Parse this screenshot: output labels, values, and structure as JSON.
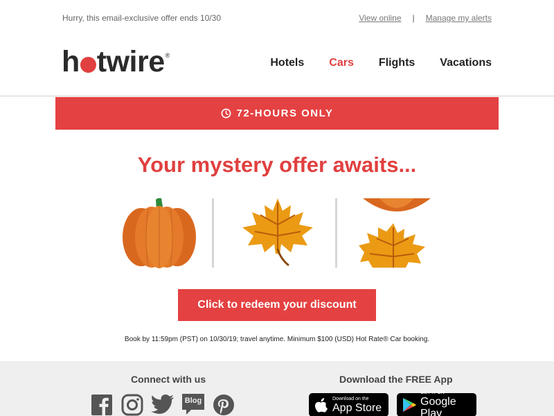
{
  "preheader": {
    "text": "Hurry, this email-exclusive offer ends 10/30",
    "view_online": "View online",
    "separator": "|",
    "manage_alerts": "Manage my alerts"
  },
  "brand": {
    "logo_left": "h",
    "logo_right": "twire",
    "registered": "®",
    "accent_color": "#e0403f"
  },
  "nav": {
    "items": [
      {
        "label": "Hotels"
      },
      {
        "label": "Cars"
      },
      {
        "label": "Flights"
      },
      {
        "label": "Vacations"
      }
    ]
  },
  "banner": {
    "text": "72-HOURS ONLY",
    "icon": "clock-icon"
  },
  "headline": "Your mystery offer awaits...",
  "images": {
    "icons": [
      "pumpkin-icon",
      "maple-leaf-icon",
      "partial-pumpkin-and-leaf-icon"
    ]
  },
  "cta": {
    "label": "Click to redeem your discount"
  },
  "fine_print": "Book by 11:59pm (PST) on 10/30/19; travel anytime. Minimum $100 (USD) Hot Rate® Car booking.",
  "footer": {
    "connect_title": "Connect with us",
    "app_title": "Download the FREE App",
    "social": [
      "facebook-icon",
      "instagram-icon",
      "twitter-icon",
      "blog-icon",
      "pinterest-icon"
    ],
    "blog_label": "Blog",
    "app_store": {
      "small": "Download on the",
      "big": "App Store"
    },
    "google_play": {
      "small": "GET IT ON",
      "big": "Google Play"
    }
  }
}
